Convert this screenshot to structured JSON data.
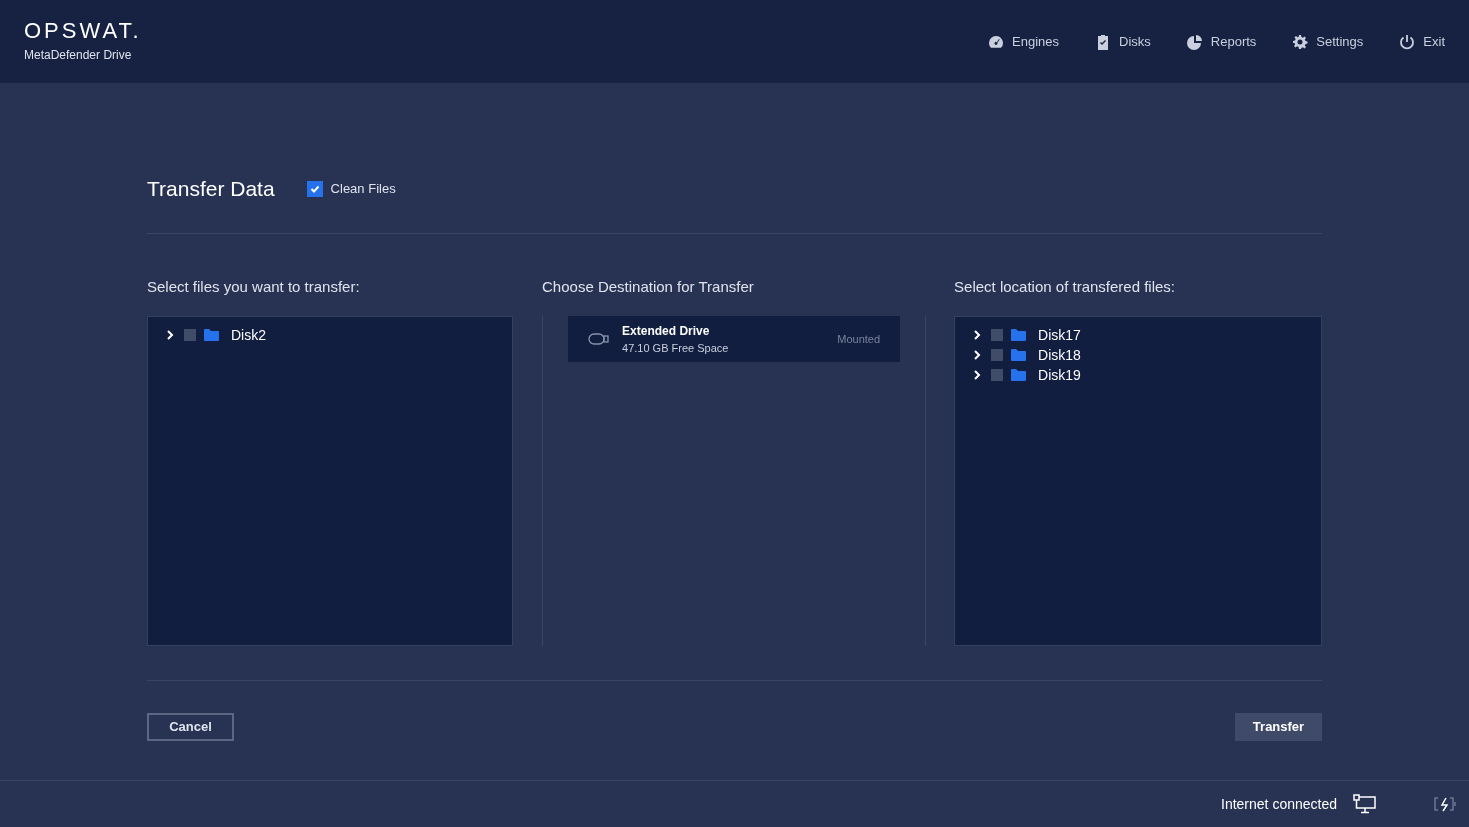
{
  "header": {
    "logo": "OPSWAT.",
    "product": "MetaDefender Drive",
    "nav": [
      {
        "kind": "engines",
        "label": "Engines"
      },
      {
        "kind": "disks",
        "label": "Disks"
      },
      {
        "kind": "reports",
        "label": "Reports"
      },
      {
        "kind": "settings",
        "label": "Settings"
      },
      {
        "kind": "exit",
        "label": "Exit"
      }
    ]
  },
  "title": "Transfer Data",
  "clean_files": {
    "label": "Clean Files",
    "checked": true
  },
  "source": {
    "heading": "Select files you want to transfer:",
    "items": [
      {
        "label": "Disk2",
        "expanded": false,
        "checked": false
      }
    ]
  },
  "destination": {
    "heading": "Choose Destination for Transfer",
    "drives": [
      {
        "name": "Extended Drive",
        "space": "47.10 GB Free Space",
        "status": "Mounted"
      }
    ]
  },
  "target": {
    "heading": "Select location of transfered files:",
    "items": [
      {
        "label": "Disk17",
        "expanded": false,
        "checked": false
      },
      {
        "label": "Disk18",
        "expanded": false,
        "checked": false
      },
      {
        "label": "Disk19",
        "expanded": false,
        "checked": false
      }
    ]
  },
  "buttons": {
    "cancel": "Cancel",
    "transfer": "Transfer"
  },
  "status_bar": {
    "connection": "Internet connected"
  }
}
